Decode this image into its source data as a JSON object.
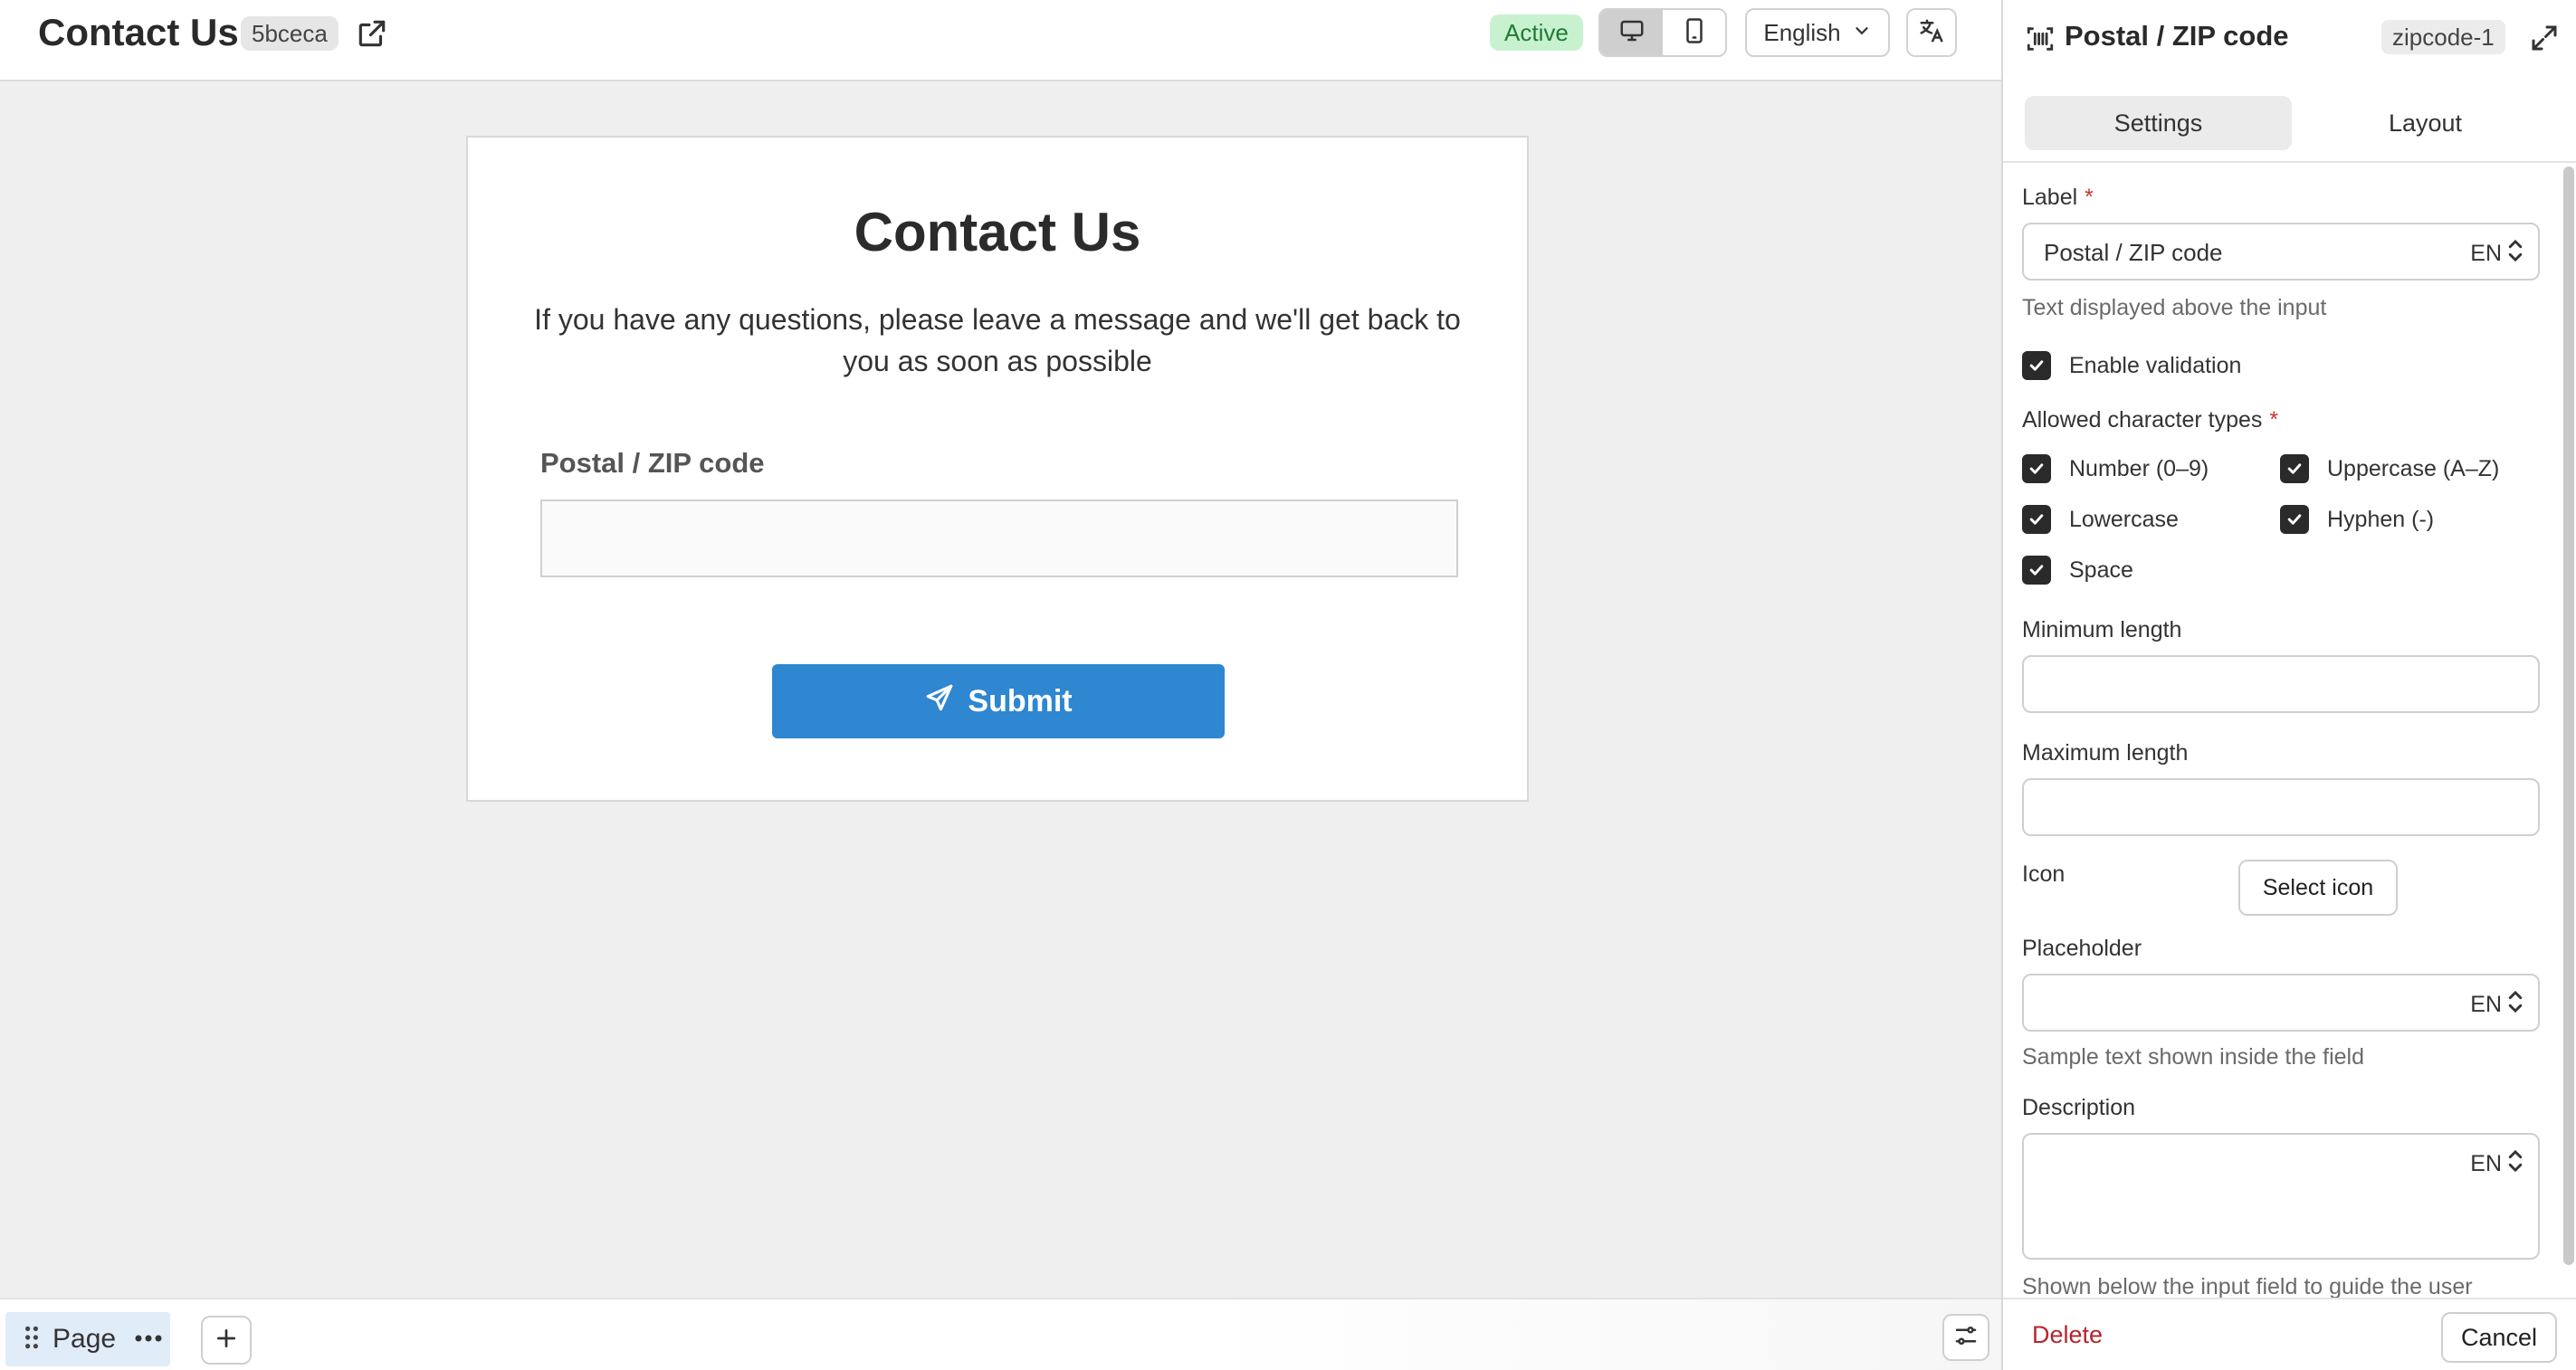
{
  "header": {
    "title": "Contact Us",
    "form_id": "5bceca",
    "status": "Active",
    "language": "English"
  },
  "form": {
    "title": "Contact Us",
    "subtitle": "If you have any questions, please leave a message and we'll get back to you as soon as possible",
    "field_label": "Postal / ZIP code",
    "field_value": "",
    "submit_label": "Submit"
  },
  "bottombar": {
    "page_label": "Page"
  },
  "panel": {
    "title": "Postal / ZIP code",
    "field_id": "zipcode-1",
    "tabs": [
      {
        "label": "Settings",
        "active": true
      },
      {
        "label": "Layout",
        "active": false
      }
    ],
    "label_field": {
      "label": "Label",
      "value": "Postal / ZIP code",
      "lang": "EN",
      "hint": "Text displayed above the input"
    },
    "enable_validation": {
      "label": "Enable validation",
      "checked": true
    },
    "char_types": {
      "label": "Allowed character types",
      "options": [
        {
          "label": "Number (0–9)",
          "checked": true
        },
        {
          "label": "Uppercase (A–Z)",
          "checked": true
        },
        {
          "label": "Lowercase",
          "checked": true
        },
        {
          "label": "Hyphen (-)",
          "checked": true
        },
        {
          "label": "Space",
          "checked": true
        }
      ]
    },
    "min_length": {
      "label": "Minimum length",
      "value": ""
    },
    "max_length": {
      "label": "Maximum length",
      "value": ""
    },
    "icon": {
      "label": "Icon",
      "button": "Select icon"
    },
    "placeholder": {
      "label": "Placeholder",
      "value": "",
      "lang": "EN",
      "hint": "Sample text shown inside the field"
    },
    "description": {
      "label": "Description",
      "value": "",
      "lang": "EN",
      "hint": "Shown below the input field to guide the user"
    },
    "footer": {
      "delete_label": "Delete",
      "cancel_label": "Cancel"
    }
  },
  "colors": {
    "accent": "#2f86d1",
    "status_bg": "#c8f2cf",
    "status_text": "#1f7a35",
    "danger": "#b3262e"
  }
}
